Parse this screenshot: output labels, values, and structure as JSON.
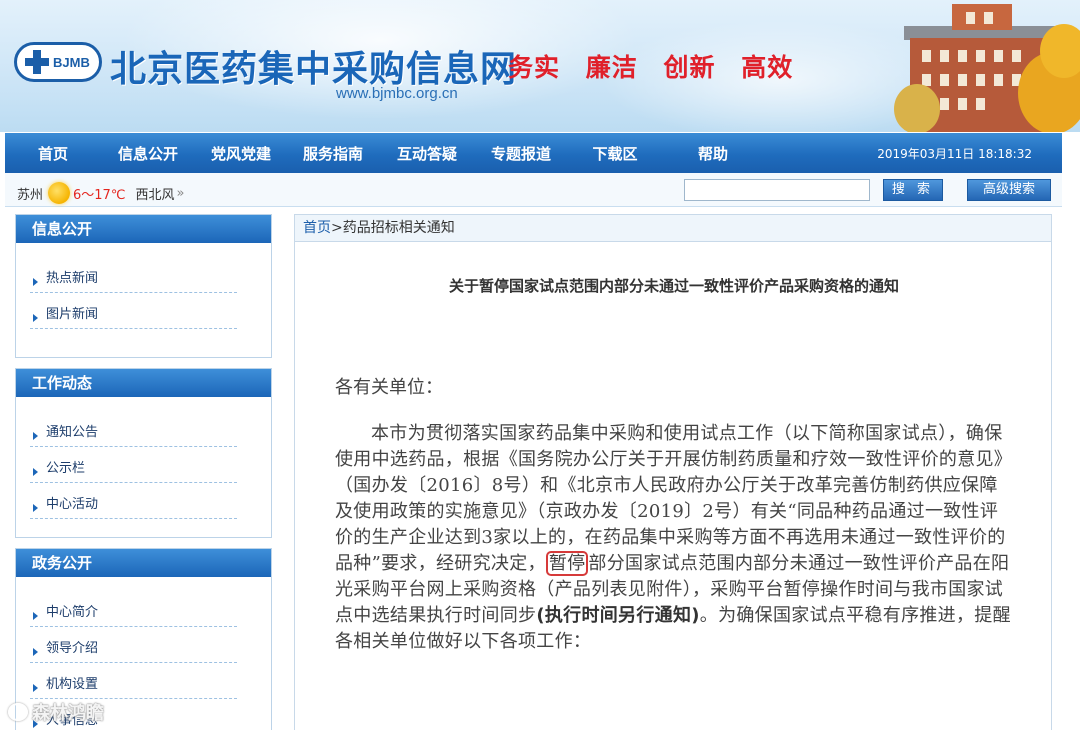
{
  "header": {
    "logo_abbr": "BJMB",
    "site_title": "北京医药集中采购信息网",
    "site_url": "www.bjmbc.org.cn",
    "slogans": [
      "务实",
      "廉洁",
      "创新",
      "高效"
    ]
  },
  "nav": {
    "items": [
      "首页",
      "信息公开",
      "党风党建",
      "服务指南",
      "互动答疑",
      "专题报道",
      "下载区",
      "帮助"
    ],
    "datetime": "2019年03月11日 18:18:32"
  },
  "infobar": {
    "city": "苏州",
    "temperature": "6～17℃",
    "wind": "西北风",
    "chevron": "»",
    "search_value": "",
    "search_button": "搜 索",
    "advanced_search": "高级搜索"
  },
  "sidebar": {
    "sections": [
      {
        "title": "信息公开",
        "items": [
          "热点新闻",
          "图片新闻"
        ]
      },
      {
        "title": "工作动态",
        "items": [
          "通知公告",
          "公示栏",
          "中心活动"
        ]
      },
      {
        "title": "政务公开",
        "items": [
          "中心简介",
          "领导介绍",
          "机构设置",
          "人事信息"
        ]
      }
    ]
  },
  "content": {
    "breadcrumb_home": "首页",
    "breadcrumb_sep": ">",
    "breadcrumb_current": "药品招标相关通知",
    "title": "关于暂停国家试点范围内部分未通过一致性评价产品采购资格的通知",
    "salutation": "各有关单位：",
    "body_part1": "本市为贯彻落实国家药品集中采购和使用试点工作（以下简称国家试点），确保使用中选药品，根据《国务院办公厅关于开展仿制药质量和疗效一致性评价的意见》（国办发〔2016〕8号）和《北京市人民政府办公厅关于改革完善仿制药供应保障及使用政策的实施意见》（京政办发〔2019〕2号）有关“同品种药品通过一致性评价的生产企业达到3家以上的，在药品集中采购等方面不再选用未通过一致性评价的品种”要求，经研究决定，",
    "body_highlight": "暂停",
    "body_part2": "部分国家试点范围内部分未通过一致性评价产品在阳光采购平台网上采购资格（产品列表见附件），采购平台暂停操作时间与我市国家试点中选结果执行时间同步",
    "body_bold": "(执行时间另行通知)",
    "body_part3": "。为确保国家试点平稳有序推进，提醒各相关单位做好以下各项工作："
  },
  "watermark": "森林鸿瞻"
}
